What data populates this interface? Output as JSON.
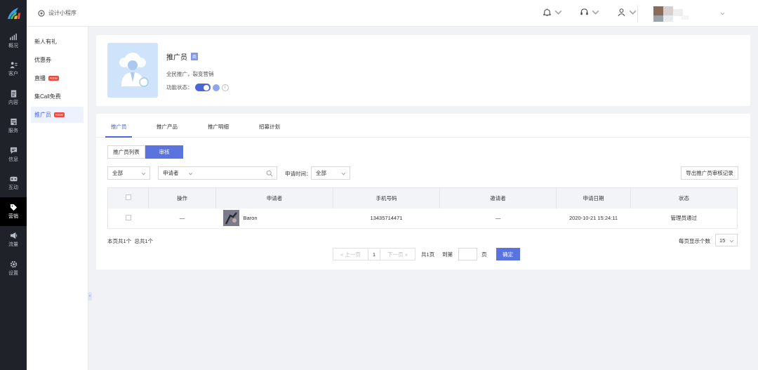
{
  "app": {
    "title": "设计小程序"
  },
  "nav": [
    {
      "label": "概况",
      "icon": "chart-icon"
    },
    {
      "label": "客户",
      "icon": "customers-icon"
    },
    {
      "label": "内容",
      "icon": "document-icon"
    },
    {
      "label": "服务",
      "icon": "service-icon"
    },
    {
      "label": "信息",
      "icon": "message-icon"
    },
    {
      "label": "互动",
      "icon": "gamepad-icon"
    },
    {
      "label": "营销",
      "icon": "tag-icon"
    },
    {
      "label": "流量",
      "icon": "megaphone-icon"
    },
    {
      "label": "设置",
      "icon": "gear-icon"
    }
  ],
  "subnav": [
    {
      "label": "新人有礼"
    },
    {
      "label": "优惠券"
    },
    {
      "label": "直播",
      "badge": "NEW"
    },
    {
      "label": "集Call免费"
    },
    {
      "label": "推广员",
      "badge": "NEW"
    }
  ],
  "feature": {
    "title": "推广员",
    "tag": "商",
    "desc": "全民推广，裂变营销",
    "status_label": "功能状态：",
    "enabled": true
  },
  "tabs": [
    "推广员",
    "推广产品",
    "推广明细",
    "招募计划"
  ],
  "segment": {
    "list": "推广员列表",
    "review": "审核"
  },
  "filters": {
    "scope": "全部",
    "field": "申请者",
    "search_value": "",
    "apply_time_label": "申请时间：",
    "apply_time": "全部",
    "export_label": "导出推广员审核记录"
  },
  "table": {
    "columns": [
      "",
      "操作",
      "申请者",
      "手机号码",
      "邀请者",
      "申请日期",
      "状态"
    ],
    "rows": [
      {
        "op": "—",
        "applicant": "Baron",
        "phone": "13435714471",
        "inviter": "—",
        "date": "2020-10-21 15:24:11",
        "status": "管理员通过"
      }
    ]
  },
  "footer": {
    "summary": "本页共1个  总共1个",
    "prev": "« 上一页",
    "page": "1",
    "next": "下一页 »",
    "total_pages": "共1页",
    "goto_label": "到第",
    "page_unit": "页",
    "ok": "确定",
    "per_page_label": "每页显示个数",
    "per_page": "15"
  },
  "colors": {
    "accent": "#4a66d8",
    "nav_bg": "#1f2329",
    "badge": "#f0473b"
  }
}
